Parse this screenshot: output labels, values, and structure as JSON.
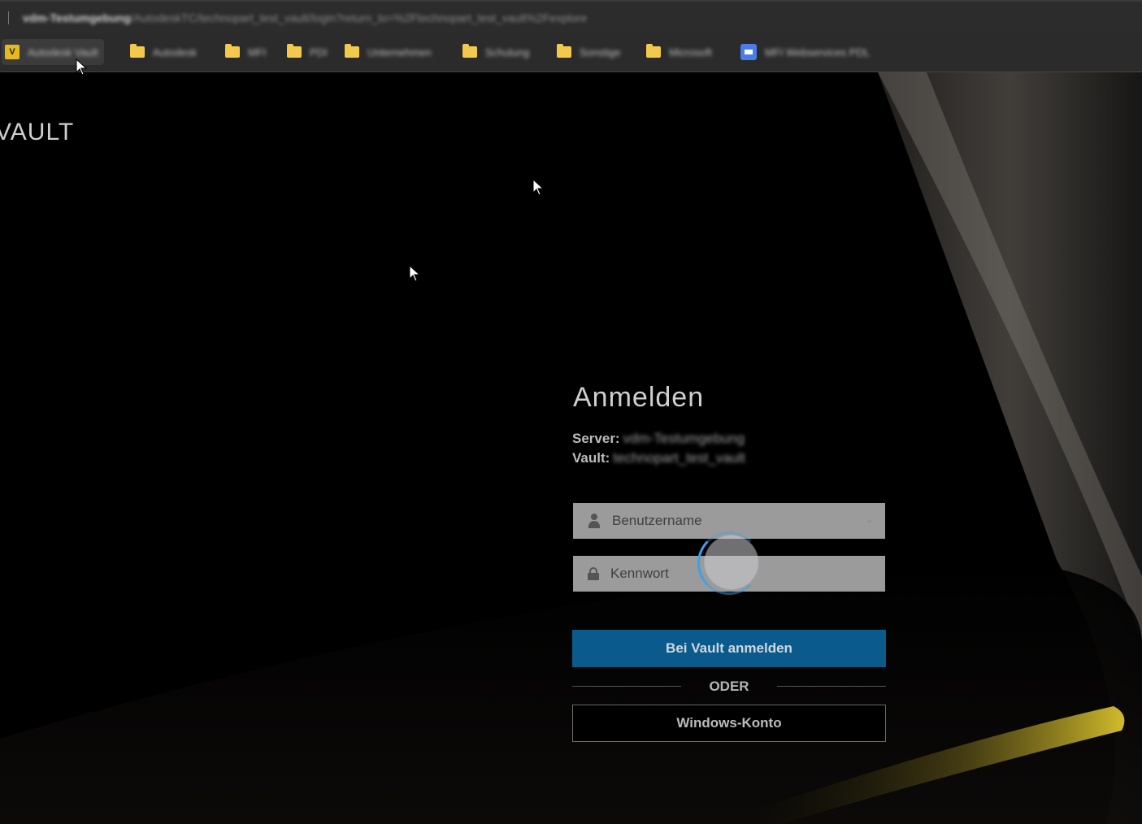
{
  "browser": {
    "url_host": "vdm-Testumgebung",
    "url_path": "/AutodeskTC/technopart_test_vault/login?return_to=%2Ftechnopart_test_vault%2Fexplore"
  },
  "bookmarks": [
    {
      "label": "Autodesk Vault",
      "icon": "vault-logo-icon"
    },
    {
      "label": "Autodesk",
      "icon": "folder-icon"
    },
    {
      "label": "MFI",
      "icon": "folder-icon"
    },
    {
      "label": "PDI",
      "icon": "folder-icon"
    },
    {
      "label": "Unternehmen",
      "icon": "folder-icon"
    },
    {
      "label": "Schulung",
      "icon": "folder-icon"
    },
    {
      "label": "Sonstige",
      "icon": "folder-icon"
    },
    {
      "label": "Microsoft",
      "icon": "folder-icon"
    },
    {
      "label": "MFI Webservices PDL",
      "icon": "microsoft-icon"
    }
  ],
  "brand": "VAULT",
  "login": {
    "title": "Anmelden",
    "server_label": "Server:",
    "server_value": "vdm-Testumgebung",
    "vault_label": "Vault:",
    "vault_value": "technopart_test_vault",
    "username_placeholder": "Benutzername",
    "password_placeholder": "Kennwort",
    "submit_label": "Bei Vault anmelden",
    "or_label": "ODER",
    "windows_label": "Windows-Konto"
  },
  "colors": {
    "primary_button": "#0a5a8c",
    "spinner": "#3ea0e8",
    "folder": "#f2c94c"
  }
}
